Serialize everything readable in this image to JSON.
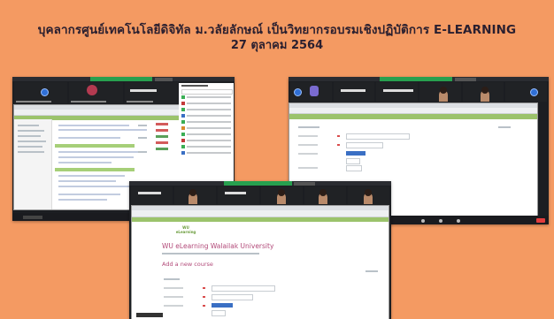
{
  "headline": {
    "line1": "บุคลากรศูนย์เทคโนโลยีดิจิทัล ม.วลัยลักษณ์ เป็นวิทยากรอบรมเชิงปฏิบัติการ E-LEARNING",
    "line2": "27 ตุลาคม 2564"
  },
  "center_screen": {
    "site_title": "WU eLearning Walailak University",
    "section_heading": "Add a new course",
    "logo_text_1": "WU",
    "logo_text_2": "eLearning"
  },
  "colors": {
    "background": "#f49a62",
    "headline_text": "#2a1f2f",
    "zoom_green": "#27a04f",
    "moodle_green": "#9bc36b",
    "wu_magenta": "#b24a79"
  }
}
